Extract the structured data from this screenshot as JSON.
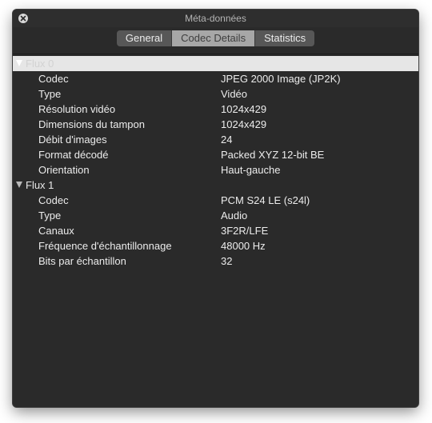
{
  "window": {
    "title": "Méta-données",
    "tabs": [
      {
        "label": "General",
        "active": false
      },
      {
        "label": "Codec Details",
        "active": true
      },
      {
        "label": "Statistics",
        "active": false
      }
    ]
  },
  "streams": [
    {
      "label": "Flux 0",
      "expanded": true,
      "selected": true,
      "rows": [
        {
          "key": "Codec",
          "value": "JPEG 2000 Image (JP2K)"
        },
        {
          "key": "Type",
          "value": "Vidéo"
        },
        {
          "key": "Résolution vidéo",
          "value": "1024x429"
        },
        {
          "key": "Dimensions du tampon",
          "value": "1024x429"
        },
        {
          "key": "Débit d'images",
          "value": "24"
        },
        {
          "key": "Format décodé",
          "value": "Packed XYZ 12-bit BE"
        },
        {
          "key": "Orientation",
          "value": "Haut-gauche"
        }
      ]
    },
    {
      "label": "Flux 1",
      "expanded": true,
      "selected": false,
      "rows": [
        {
          "key": "Codec",
          "value": "PCM S24 LE (s24l)"
        },
        {
          "key": "Type",
          "value": "Audio"
        },
        {
          "key": "Canaux",
          "value": "3F2R/LFE"
        },
        {
          "key": "Fréquence d'échantillonnage",
          "value": "48000 Hz"
        },
        {
          "key": "Bits par échantillon",
          "value": "32"
        }
      ]
    }
  ],
  "icons": {
    "close": "close-icon",
    "disclosure": "disclosure-triangle-icon"
  }
}
